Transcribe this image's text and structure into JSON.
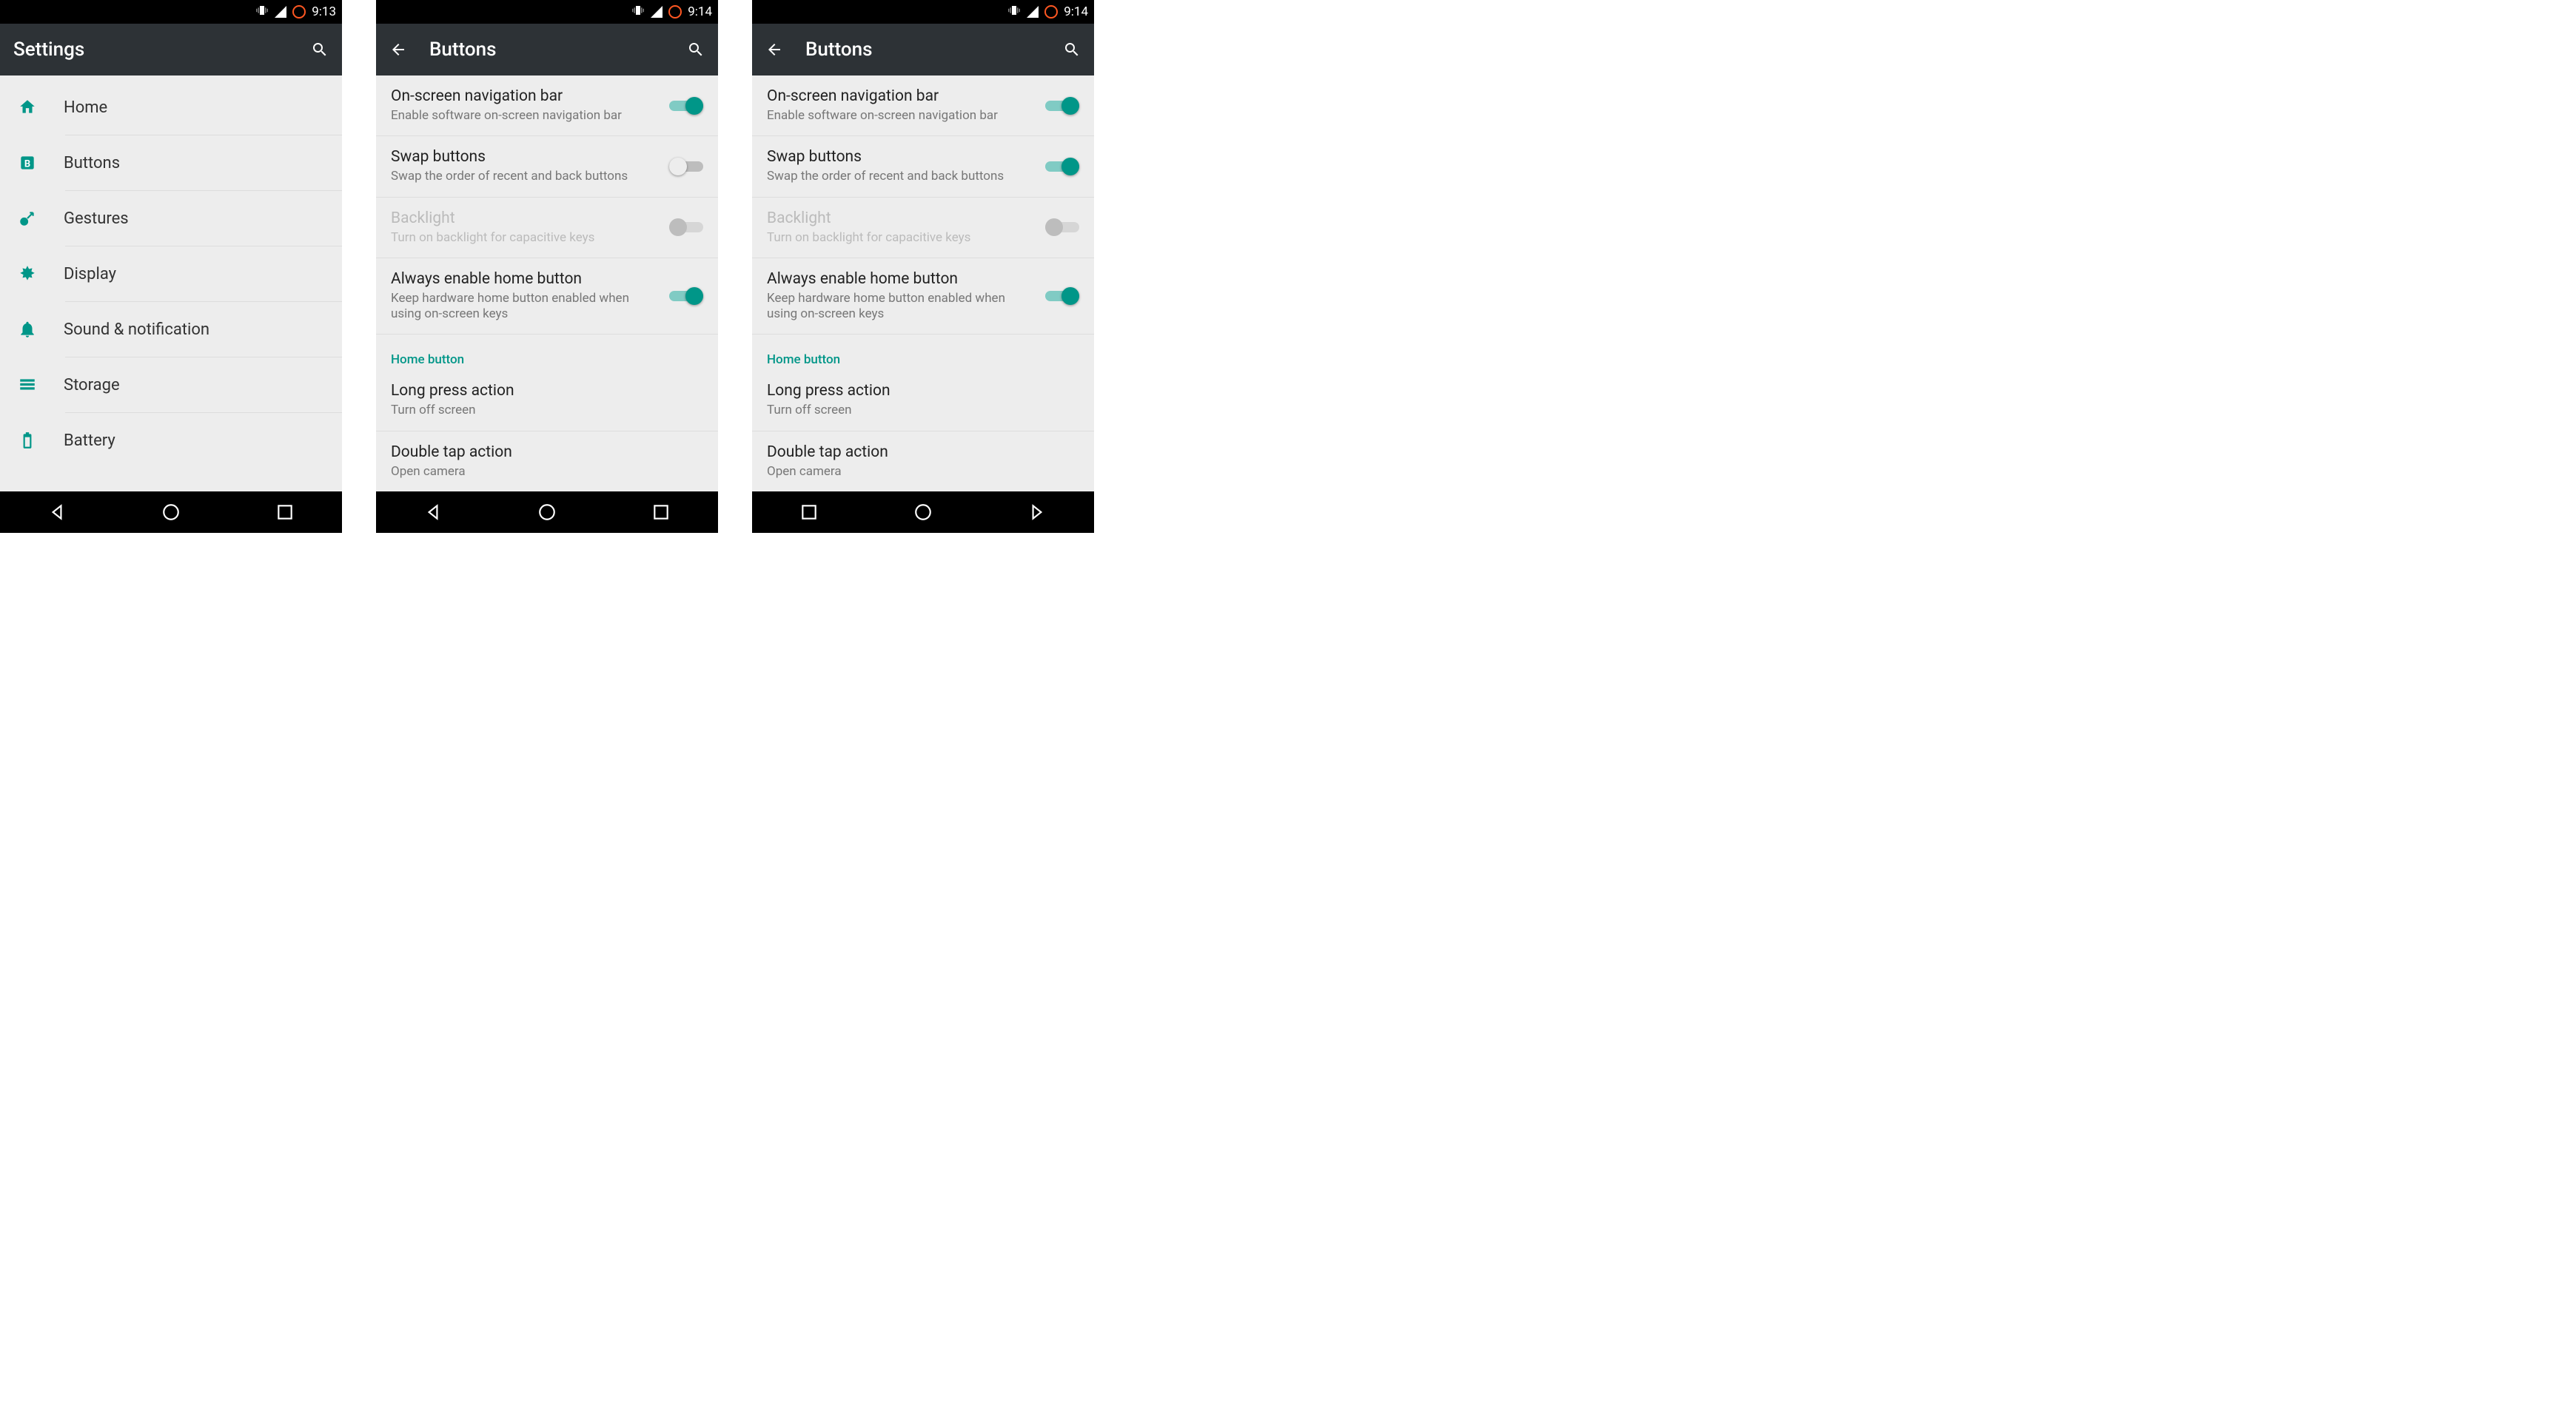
{
  "colors": {
    "accent": "#009688",
    "actionbar": "#2d3236"
  },
  "screens": [
    {
      "statusbar_time": "9:13",
      "title": "Settings",
      "has_back": false,
      "navbar_order": "normal",
      "settings_items": [
        {
          "icon": "home",
          "label": "Home"
        },
        {
          "icon": "buttons",
          "label": "Buttons"
        },
        {
          "icon": "gestures",
          "label": "Gestures"
        },
        {
          "icon": "display",
          "label": "Display"
        },
        {
          "icon": "bell",
          "label": "Sound & notification"
        },
        {
          "icon": "storage",
          "label": "Storage"
        },
        {
          "icon": "battery",
          "label": "Battery"
        }
      ]
    },
    {
      "statusbar_time": "9:14",
      "title": "Buttons",
      "has_back": true,
      "navbar_order": "normal",
      "rows": [
        {
          "title": "On-screen navigation bar",
          "subtitle": "Enable software on-screen navigation bar",
          "toggle": "on"
        },
        {
          "title": "Swap buttons",
          "subtitle": "Swap the order of recent and back buttons",
          "toggle": "off"
        },
        {
          "title": "Backlight",
          "subtitle": "Turn on backlight for capacitive keys",
          "toggle": "disabled",
          "disabled": true
        },
        {
          "title": "Always enable home button",
          "subtitle": "Keep hardware home button enabled when using on-screen keys",
          "toggle": "on"
        }
      ],
      "section_header": "Home button",
      "section_rows": [
        {
          "title": "Long press action",
          "subtitle": "Turn off screen"
        },
        {
          "title": "Double tap action",
          "subtitle": "Open camera"
        }
      ]
    },
    {
      "statusbar_time": "9:14",
      "title": "Buttons",
      "has_back": true,
      "navbar_order": "swapped",
      "rows": [
        {
          "title": "On-screen navigation bar",
          "subtitle": "Enable software on-screen navigation bar",
          "toggle": "on"
        },
        {
          "title": "Swap buttons",
          "subtitle": "Swap the order of recent and back buttons",
          "toggle": "on"
        },
        {
          "title": "Backlight",
          "subtitle": "Turn on backlight for capacitive keys",
          "toggle": "disabled",
          "disabled": true
        },
        {
          "title": "Always enable home button",
          "subtitle": "Keep hardware home button enabled when using on-screen keys",
          "toggle": "on"
        }
      ],
      "section_header": "Home button",
      "section_rows": [
        {
          "title": "Long press action",
          "subtitle": "Turn off screen"
        },
        {
          "title": "Double tap action",
          "subtitle": "Open camera"
        }
      ]
    }
  ]
}
